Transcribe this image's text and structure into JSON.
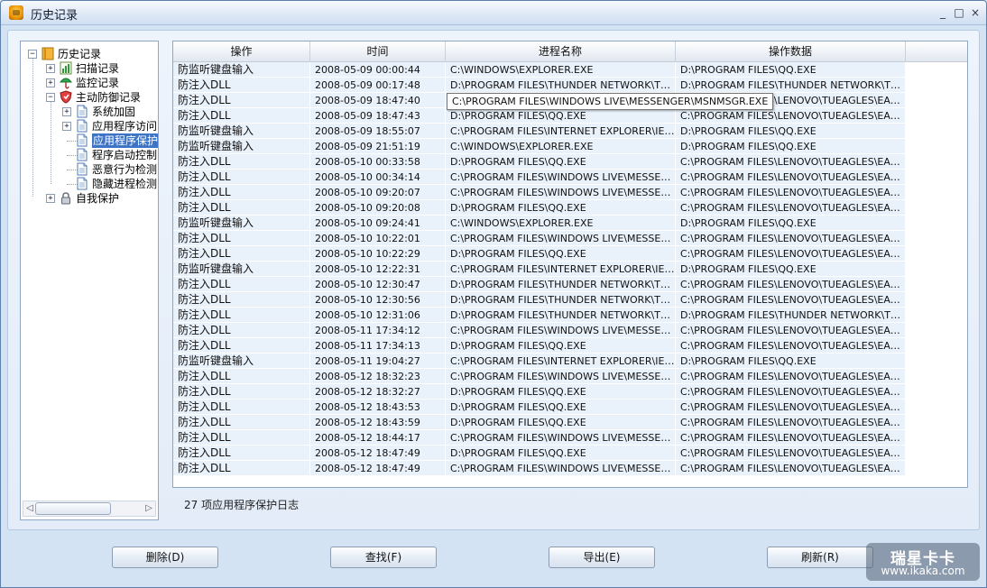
{
  "window": {
    "title": "历史记录"
  },
  "titlebar_buttons": [
    "_",
    "□",
    "×"
  ],
  "tree": [
    {
      "label": "历史记录",
      "expander": "−",
      "icon": "book-icon",
      "level": 0
    },
    {
      "label": "扫描记录",
      "expander": "+",
      "icon": "scan-chart-icon",
      "level": 1
    },
    {
      "label": "监控记录",
      "expander": "+",
      "icon": "monitor-umbrella-icon",
      "level": 1
    },
    {
      "label": "主动防御记录",
      "expander": "−",
      "icon": "shield-icon",
      "level": 1
    },
    {
      "label": "系统加固",
      "expander": "+",
      "icon": "document-icon",
      "level": 2
    },
    {
      "label": "应用程序访问",
      "expander": "+",
      "icon": "document-icon",
      "level": 2
    },
    {
      "label": "应用程序保护",
      "expander": "",
      "icon": "document-icon",
      "level": 2,
      "selected": true
    },
    {
      "label": "程序启动控制",
      "expander": "",
      "icon": "document-icon",
      "level": 2
    },
    {
      "label": "恶意行为检测",
      "expander": "",
      "icon": "document-icon",
      "level": 2
    },
    {
      "label": "隐藏进程检测",
      "expander": "",
      "icon": "document-icon",
      "level": 2
    },
    {
      "label": "自我保护",
      "expander": "+",
      "icon": "lock-icon",
      "level": 1
    }
  ],
  "table": {
    "columns": [
      "操作",
      "时间",
      "进程名称",
      "操作数据"
    ],
    "rows": [
      [
        "防监听键盘输入",
        "2008-05-09 00:00:44",
        "C:\\WINDOWS\\EXPLORER.EXE",
        "D:\\PROGRAM FILES\\QQ.EXE"
      ],
      [
        "防注入DLL",
        "2008-05-09 00:17:48",
        "D:\\PROGRAM FILES\\THUNDER NETWORK\\THUND...",
        "D:\\PROGRAM FILES\\THUNDER NETWORK\\THUND..."
      ],
      [
        "防注入DLL",
        "2008-05-09 18:47:40",
        "C:\\PROGRAM FILES\\WINDOWS LIVE\\MESSENGER...",
        "C:\\PROGRAM FILES\\LENOVO\\TUEAGLES\\EAGLEH..."
      ],
      [
        "防注入DLL",
        "2008-05-09 18:47:43",
        "D:\\PROGRAM FILES\\QQ.EXE",
        "C:\\PROGRAM FILES\\LENOVO\\TUEAGLES\\EAGLEH..."
      ],
      [
        "防监听键盘输入",
        "2008-05-09 18:55:07",
        "C:\\PROGRAM FILES\\INTERNET EXPLORER\\IEXPL...",
        "D:\\PROGRAM FILES\\QQ.EXE"
      ],
      [
        "防监听键盘输入",
        "2008-05-09 21:51:19",
        "C:\\WINDOWS\\EXPLORER.EXE",
        "D:\\PROGRAM FILES\\QQ.EXE"
      ],
      [
        "防注入DLL",
        "2008-05-10 00:33:58",
        "D:\\PROGRAM FILES\\QQ.EXE",
        "C:\\PROGRAM FILES\\LENOVO\\TUEAGLES\\EAGLEH..."
      ],
      [
        "防注入DLL",
        "2008-05-10 00:34:14",
        "C:\\PROGRAM FILES\\WINDOWS LIVE\\MESSENGER...",
        "C:\\PROGRAM FILES\\LENOVO\\TUEAGLES\\EAGLEH..."
      ],
      [
        "防注入DLL",
        "2008-05-10 09:20:07",
        "C:\\PROGRAM FILES\\WINDOWS LIVE\\MESSENGER...",
        "C:\\PROGRAM FILES\\LENOVO\\TUEAGLES\\EAGLEH..."
      ],
      [
        "防注入DLL",
        "2008-05-10 09:20:08",
        "D:\\PROGRAM FILES\\QQ.EXE",
        "C:\\PROGRAM FILES\\LENOVO\\TUEAGLES\\EAGLEH..."
      ],
      [
        "防监听键盘输入",
        "2008-05-10 09:24:41",
        "C:\\WINDOWS\\EXPLORER.EXE",
        "D:\\PROGRAM FILES\\QQ.EXE"
      ],
      [
        "防注入DLL",
        "2008-05-10 10:22:01",
        "C:\\PROGRAM FILES\\WINDOWS LIVE\\MESSENGER...",
        "C:\\PROGRAM FILES\\LENOVO\\TUEAGLES\\EAGLEH..."
      ],
      [
        "防注入DLL",
        "2008-05-10 10:22:29",
        "D:\\PROGRAM FILES\\QQ.EXE",
        "C:\\PROGRAM FILES\\LENOVO\\TUEAGLES\\EAGLEH..."
      ],
      [
        "防监听键盘输入",
        "2008-05-10 12:22:31",
        "C:\\PROGRAM FILES\\INTERNET EXPLORER\\IEXPL...",
        "D:\\PROGRAM FILES\\QQ.EXE"
      ],
      [
        "防注入DLL",
        "2008-05-10 12:30:47",
        "D:\\PROGRAM FILES\\THUNDER NETWORK\\THUND...",
        "C:\\PROGRAM FILES\\LENOVO\\TUEAGLES\\EAGLEH..."
      ],
      [
        "防注入DLL",
        "2008-05-10 12:30:56",
        "D:\\PROGRAM FILES\\THUNDER NETWORK\\THUND...",
        "C:\\PROGRAM FILES\\LENOVO\\TUEAGLES\\EAGLEH..."
      ],
      [
        "防注入DLL",
        "2008-05-10 12:31:06",
        "D:\\PROGRAM FILES\\THUNDER NETWORK\\THUND...",
        "D:\\PROGRAM FILES\\THUNDER NETWORK\\THUND..."
      ],
      [
        "防注入DLL",
        "2008-05-11 17:34:12",
        "C:\\PROGRAM FILES\\WINDOWS LIVE\\MESSENGER...",
        "C:\\PROGRAM FILES\\LENOVO\\TUEAGLES\\EAGLEH..."
      ],
      [
        "防注入DLL",
        "2008-05-11 17:34:13",
        "D:\\PROGRAM FILES\\QQ.EXE",
        "C:\\PROGRAM FILES\\LENOVO\\TUEAGLES\\EAGLEH..."
      ],
      [
        "防监听键盘输入",
        "2008-05-11 19:04:27",
        "C:\\PROGRAM FILES\\INTERNET EXPLORER\\IEXPL...",
        "D:\\PROGRAM FILES\\QQ.EXE"
      ],
      [
        "防注入DLL",
        "2008-05-12 18:32:23",
        "C:\\PROGRAM FILES\\WINDOWS LIVE\\MESSENGER...",
        "C:\\PROGRAM FILES\\LENOVO\\TUEAGLES\\EAGLEH..."
      ],
      [
        "防注入DLL",
        "2008-05-12 18:32:27",
        "D:\\PROGRAM FILES\\QQ.EXE",
        "C:\\PROGRAM FILES\\LENOVO\\TUEAGLES\\EAGLEH..."
      ],
      [
        "防注入DLL",
        "2008-05-12 18:43:53",
        "D:\\PROGRAM FILES\\QQ.EXE",
        "C:\\PROGRAM FILES\\LENOVO\\TUEAGLES\\EAGLEH..."
      ],
      [
        "防注入DLL",
        "2008-05-12 18:43:59",
        "D:\\PROGRAM FILES\\QQ.EXE",
        "C:\\PROGRAM FILES\\LENOVO\\TUEAGLES\\EAGLEH..."
      ],
      [
        "防注入DLL",
        "2008-05-12 18:44:17",
        "C:\\PROGRAM FILES\\WINDOWS LIVE\\MESSENGER...",
        "C:\\PROGRAM FILES\\LENOVO\\TUEAGLES\\EAGLEH..."
      ],
      [
        "防注入DLL",
        "2008-05-12 18:47:49",
        "D:\\PROGRAM FILES\\QQ.EXE",
        "C:\\PROGRAM FILES\\LENOVO\\TUEAGLES\\EAGLEH..."
      ],
      [
        "防注入DLL",
        "2008-05-12 18:47:49",
        "C:\\PROGRAM FILES\\WINDOWS LIVE\\MESSENGER...",
        "C:\\PROGRAM FILES\\LENOVO\\TUEAGLES\\EAGLEH..."
      ]
    ]
  },
  "tooltip": "C:\\PROGRAM FILES\\WINDOWS LIVE\\MESSENGER\\MSNMSGR.EXE",
  "status": "27 项应用程序保护日志",
  "buttons": {
    "delete": "删除(D)",
    "find": "查找(F)",
    "export": "导出(E)",
    "refresh": "刷新(R)"
  },
  "watermark": {
    "brand": "瑞星卡卡",
    "url": "www.ikaka.com"
  },
  "colors": {
    "selection": "#3d74c6",
    "row_bg": "#e9f1fb",
    "border": "#8ea5c4"
  }
}
